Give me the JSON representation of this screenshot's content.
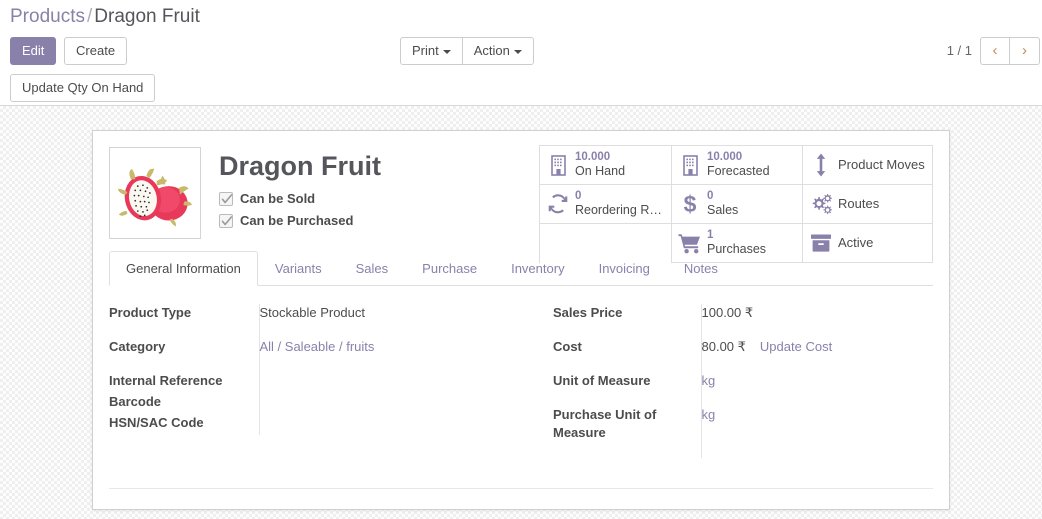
{
  "breadcrumb": {
    "parent": "Products",
    "separator": "/",
    "current": "Dragon Fruit"
  },
  "toolbar": {
    "edit_label": "Edit",
    "create_label": "Create",
    "print_label": "Print",
    "action_label": "Action",
    "update_qty_label": "Update Qty On Hand",
    "pager_value": "1 / 1",
    "prev_glyph": "‹",
    "next_glyph": "›"
  },
  "product": {
    "title": "Dragon Fruit",
    "image_icon": "dragon-fruit-photo",
    "can_be_sold_label": "Can be Sold",
    "can_be_sold_checked": true,
    "can_be_purchased_label": "Can be Purchased",
    "can_be_purchased_checked": true
  },
  "stat_buttons": [
    {
      "value": "10.000",
      "label": "On Hand",
      "icon": "building-icon"
    },
    {
      "value": "10.000",
      "label": "Forecasted",
      "icon": "building-icon"
    },
    {
      "value": "",
      "label": "Product Moves",
      "icon": "arrows-v-icon"
    },
    {
      "value": "0",
      "label": "Reordering R…",
      "icon": "refresh-icon"
    },
    {
      "value": "0",
      "label": "Sales",
      "icon": "dollar-icon"
    },
    {
      "value": "",
      "label": "Routes",
      "icon": "cogs-icon"
    },
    {
      "value": "1",
      "label": "Purchases",
      "icon": "shopping-cart-icon"
    },
    {
      "value": "",
      "label": "Active",
      "icon": "archive-box-icon"
    }
  ],
  "tabs": [
    {
      "label": "General Information",
      "active": true
    },
    {
      "label": "Variants",
      "active": false
    },
    {
      "label": "Sales",
      "active": false
    },
    {
      "label": "Purchase",
      "active": false
    },
    {
      "label": "Inventory",
      "active": false
    },
    {
      "label": "Invoicing",
      "active": false
    },
    {
      "label": "Notes",
      "active": false
    }
  ],
  "general_information": {
    "left": {
      "product_type_label": "Product Type",
      "product_type_value": "Stockable Product",
      "category_label": "Category",
      "category_value": "All / Saleable / fruits",
      "internal_reference_label": "Internal Reference",
      "internal_reference_value": "",
      "barcode_label": "Barcode",
      "barcode_value": "",
      "hsn_label": "HSN/SAC Code",
      "hsn_value": ""
    },
    "right": {
      "sales_price_label": "Sales Price",
      "sales_price_value": "100.00 ₹",
      "cost_label": "Cost",
      "cost_value": "80.00 ₹",
      "update_cost_label": "Update Cost",
      "uom_label": "Unit of Measure",
      "uom_value": "kg",
      "purchase_uom_label": "Purchase Unit of Measure",
      "purchase_uom_value": "kg"
    }
  },
  "colors": {
    "accent": "#8a81ab",
    "text": "#4c4c4c",
    "title": "#55555c",
    "pager_arrow": "#c08a5a"
  }
}
